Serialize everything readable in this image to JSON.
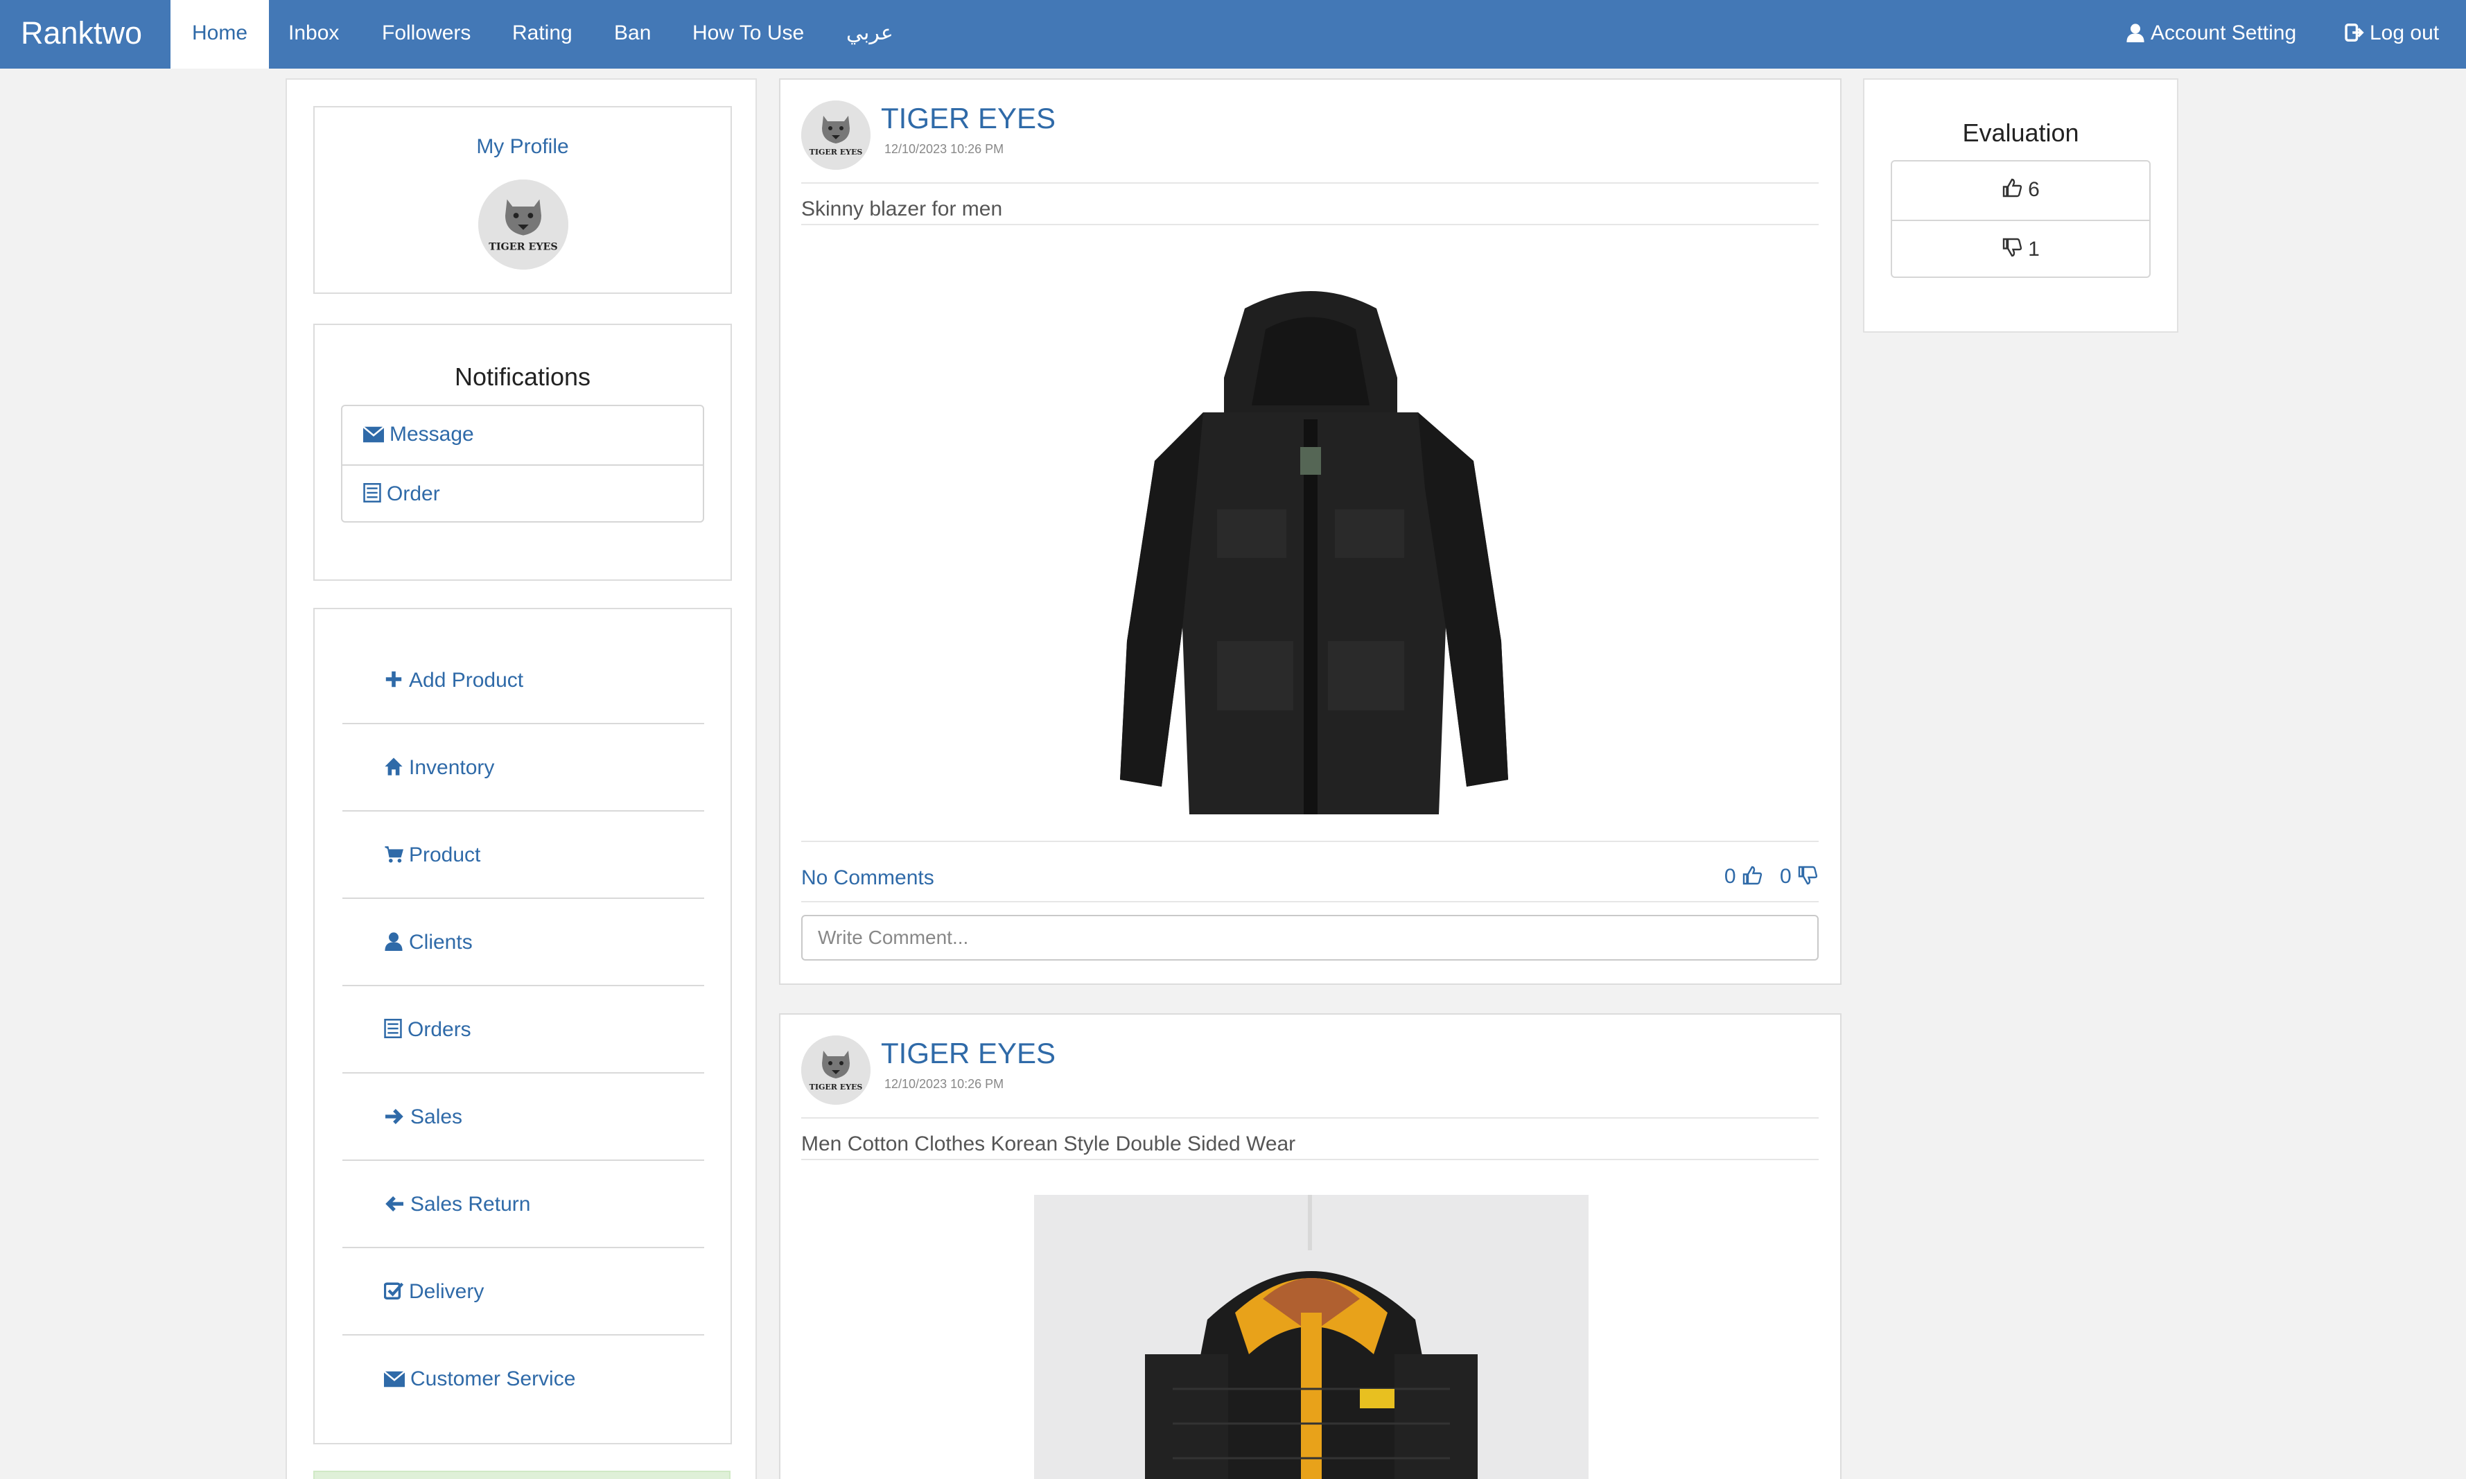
{
  "nav": {
    "brand": "Ranktwo",
    "items": [
      {
        "label": "Home",
        "active": true
      },
      {
        "label": "Inbox"
      },
      {
        "label": "Followers"
      },
      {
        "label": "Rating"
      },
      {
        "label": "Ban"
      },
      {
        "label": "How To Use"
      },
      {
        "label": "عربي"
      }
    ],
    "account_setting": "Account Setting",
    "logout": "Log out"
  },
  "profile": {
    "title": "My Profile",
    "avatar_text": "TIGER EYES"
  },
  "notifications": {
    "title": "Notifications",
    "items": [
      {
        "label": "Message",
        "icon": "envelope-icon"
      },
      {
        "label": "Order",
        "icon": "list-icon"
      }
    ]
  },
  "menu": {
    "items": [
      {
        "label": "Add Product",
        "icon": "plus-icon"
      },
      {
        "label": "Inventory",
        "icon": "home-icon"
      },
      {
        "label": "Product",
        "icon": "cart-icon"
      },
      {
        "label": "Clients",
        "icon": "user-icon"
      },
      {
        "label": "Orders",
        "icon": "list-icon"
      },
      {
        "label": "Sales",
        "icon": "arrow-right-icon"
      },
      {
        "label": "Sales Return",
        "icon": "arrow-left-icon"
      },
      {
        "label": "Delivery",
        "icon": "check-square-icon"
      },
      {
        "label": "Customer Service",
        "icon": "envelope-icon"
      }
    ]
  },
  "posts": [
    {
      "author": "TIGER EYES",
      "date": "12/10/2023 10:26 PM",
      "description": "Skinny blazer for men",
      "comments_label": "No Comments",
      "likes": "0",
      "dislikes": "0",
      "comment_placeholder": "Write Comment..."
    },
    {
      "author": "TIGER EYES",
      "date": "12/10/2023 10:26 PM",
      "description": "Men Cotton Clothes Korean Style Double Sided Wear"
    }
  ],
  "evaluation": {
    "title": "Evaluation",
    "likes": "6",
    "dislikes": "1"
  },
  "colors": {
    "navbar": "#4378b6",
    "link": "#2f6aa8",
    "background": "#f2f2f2"
  }
}
